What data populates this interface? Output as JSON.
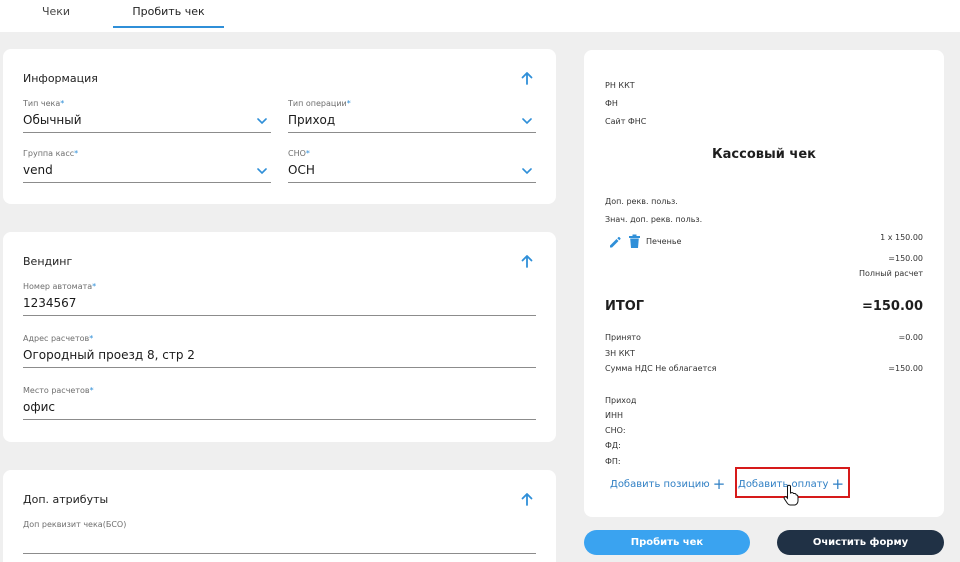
{
  "tabs": [
    {
      "label": "Чеки"
    },
    {
      "label": "Пробить чек"
    }
  ],
  "info": {
    "title": "Информация",
    "fields": {
      "receipt_type": {
        "label": "Тип чека",
        "value": "Обычный"
      },
      "operation_type": {
        "label": "Тип операции",
        "value": "Приход"
      },
      "register_group": {
        "label": "Группа касс",
        "value": "vend"
      },
      "tax_system": {
        "label": "СНО",
        "value": "ОСН"
      }
    }
  },
  "vending": {
    "title": "Вендинг",
    "machine_number": {
      "label": "Номер автомата",
      "value": "1234567"
    },
    "address": {
      "label": "Адрес расчетов",
      "value": "Огородный проезд 8, стр 2"
    },
    "place": {
      "label": "Место расчетов",
      "value": "офис"
    }
  },
  "extra": {
    "title": "Доп. атрибуты",
    "bso": {
      "label": "Доп реквизит чека(БСО)",
      "value": ""
    }
  },
  "receipt": {
    "header_lines": [
      "РН ККТ",
      "ФН",
      "Сайт ФНС"
    ],
    "title": "Кассовый чек",
    "user_req_label": "Доп. рекв. польз.",
    "user_req_value_label": "Знач. доп. рекв. польз.",
    "item": {
      "name": "Печенье",
      "qty_price": "1 x 150.00",
      "sum": "=150.00",
      "payment_mode": "Полный расчет"
    },
    "total_label": "ИТОГ",
    "total_value": "=150.00",
    "accepted_label": "Принято",
    "accepted_value": "=0.00",
    "kkt_serial_label": "ЗН ККТ",
    "vat_label": "Сумма НДС Не облагается",
    "vat_value": "=150.00",
    "footer_lines": [
      "Приход",
      "ИНН",
      "СНО:",
      "ФД:",
      "ФП:"
    ],
    "add_position": "Добавить позицию",
    "add_payment": "Добавить оплату"
  },
  "buttons": {
    "submit": "Пробить чек",
    "clear": "Очистить форму"
  },
  "colors": {
    "accent": "#2f8fd8",
    "primary_button": "#3aa3f0",
    "dark_button": "#203145",
    "highlight": "#d61a1a"
  }
}
